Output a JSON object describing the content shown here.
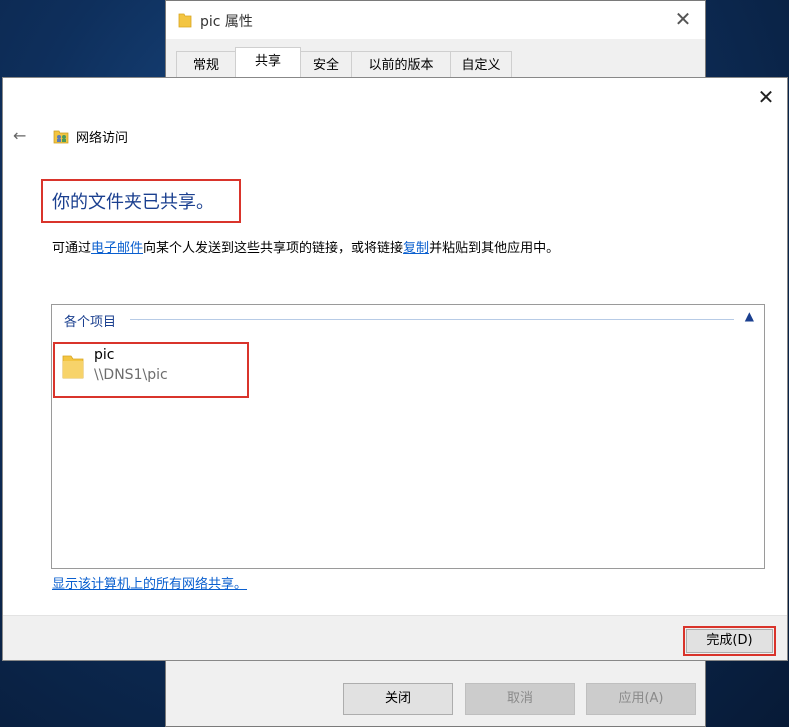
{
  "props_window": {
    "title": "pic 属性",
    "tabs": [
      "常规",
      "共享",
      "安全",
      "以前的版本",
      "自定义"
    ],
    "active_tab": "共享",
    "buttons": {
      "close": "关闭",
      "cancel": "取消",
      "apply": "应用(A)"
    }
  },
  "wizard": {
    "nav_title": "网络访问",
    "headline": "你的文件夹已共享。",
    "desc": {
      "part1": "可通过",
      "email_link": "电子邮件",
      "part2": "向某个人发送到这些共享项的链接，或将链接",
      "copy_link": "复制",
      "part3": "并粘贴到其他应用中。"
    },
    "group_label": "各个项目",
    "item": {
      "name": "pic",
      "path": "\\\\DNS1\\pic"
    },
    "all_shares_link": "显示该计算机上的所有网络共享。",
    "done_label": "完成(D)"
  },
  "colors": {
    "highlight_red": "#d9342b",
    "link_blue": "#0a5fcf",
    "headline_blue": "#1a3f8f"
  }
}
